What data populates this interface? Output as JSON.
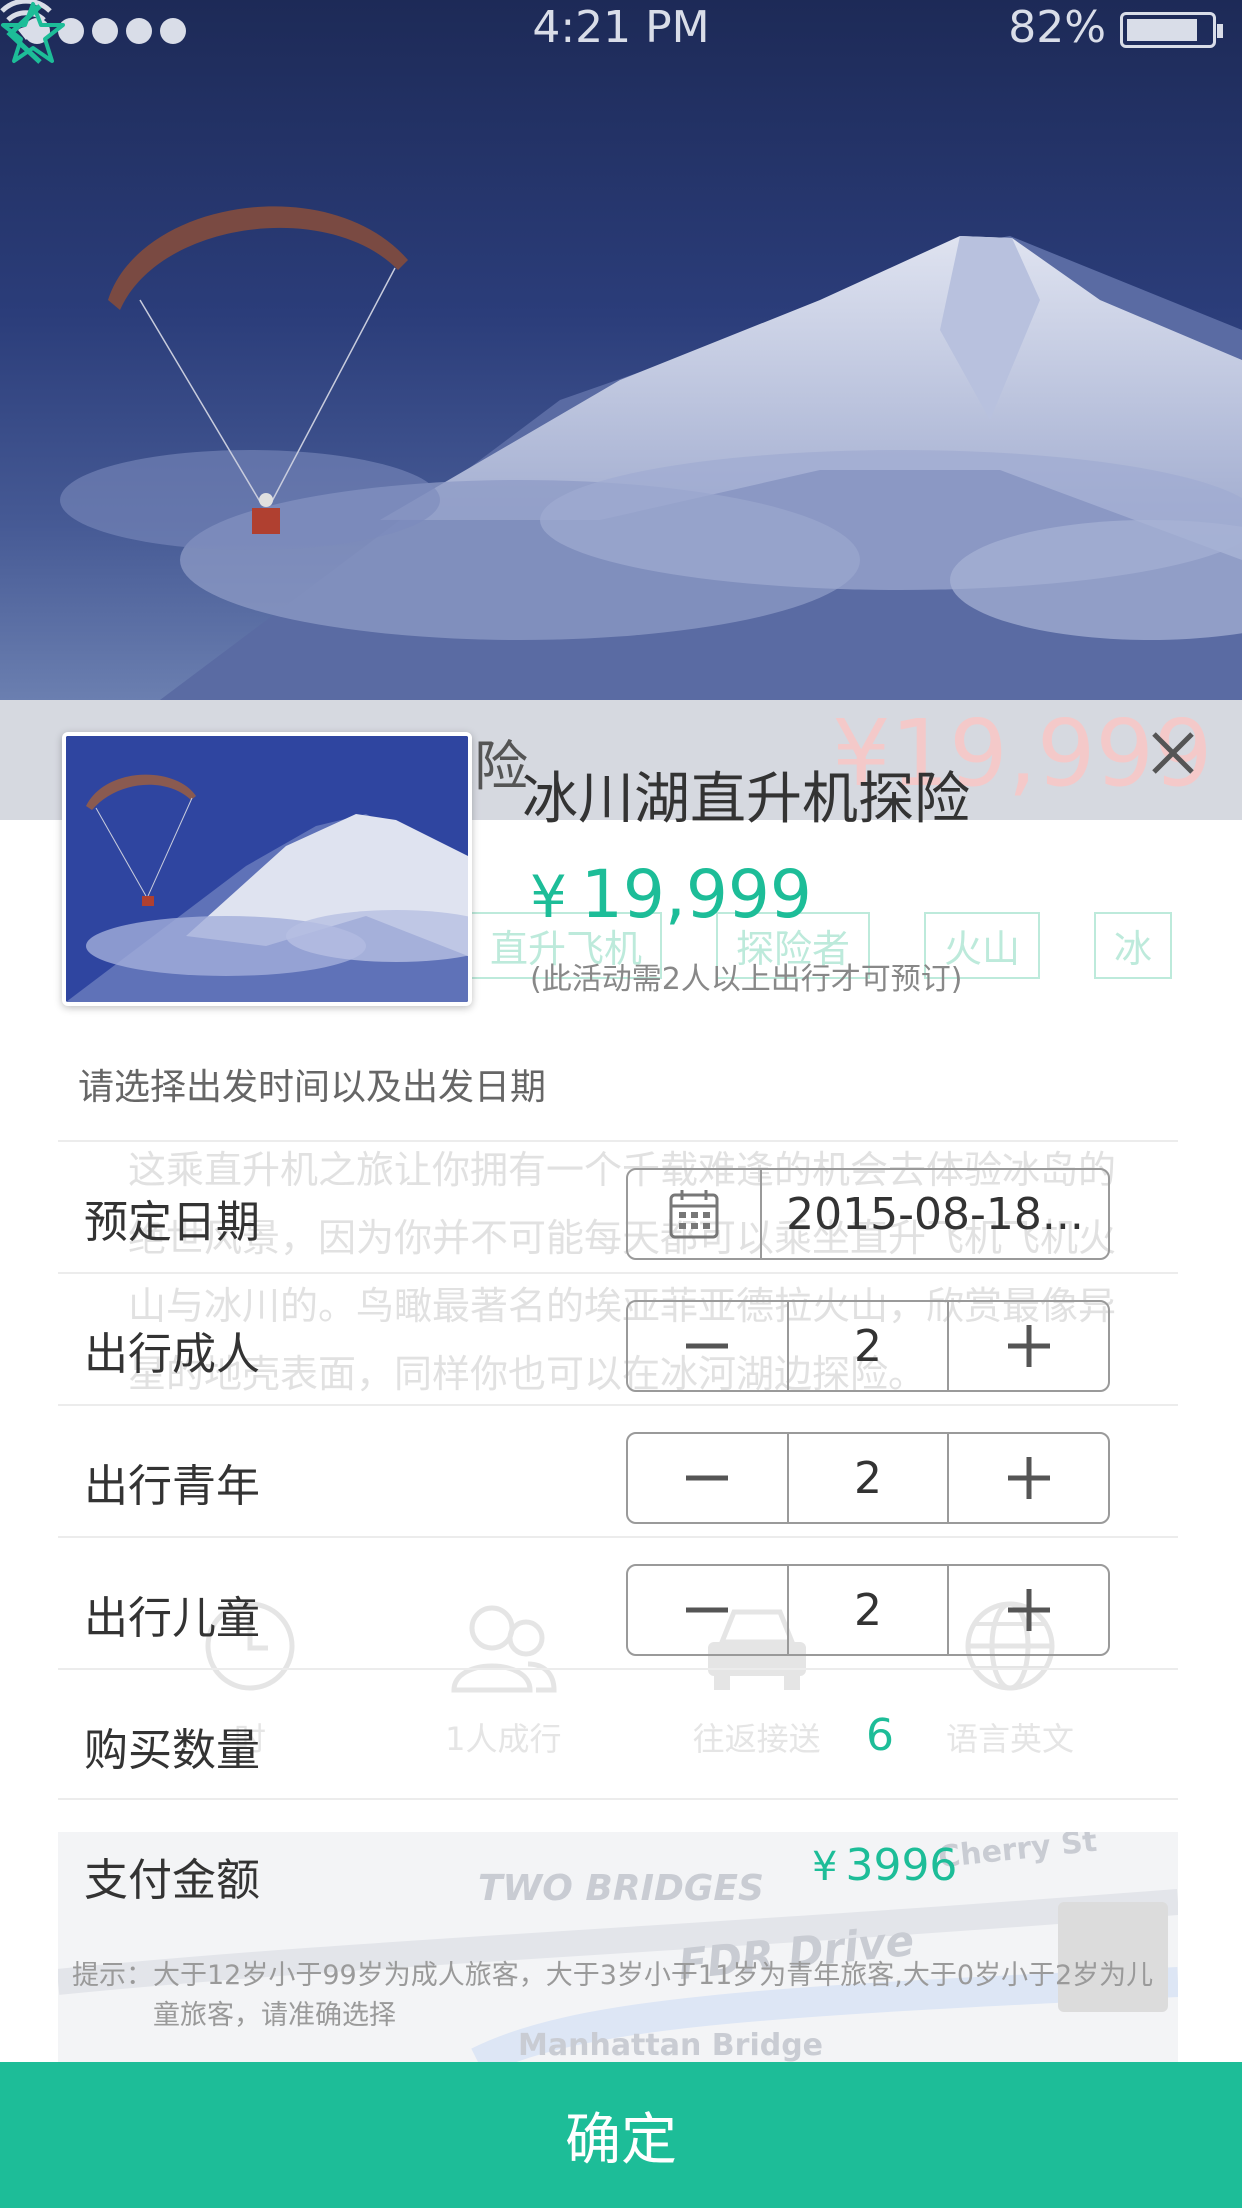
{
  "status_bar": {
    "time": "4:21 PM",
    "battery": "82%"
  },
  "background_page": {
    "title_fragment": "探险",
    "price": "¥19,999",
    "tags": [
      "直升飞机",
      "探险者",
      "火山",
      "冰"
    ],
    "description": "这乘直升机之旅让你拥有一个千载难逢的机会去体验冰岛的绝世风景，因为你并不可能每天都可以乘坐直升飞机飞机火山与冰川的。鸟瞰最著名的埃亚菲亚德拉火山，欣赏最像异星的地壳表面，同样你也可以在冰河湖边探险。",
    "features": [
      {
        "icon": "clock-icon",
        "label": "时"
      },
      {
        "icon": "people-icon",
        "label": "1人成行"
      },
      {
        "icon": "car-icon",
        "label": "往返接送"
      },
      {
        "icon": "globe-icon",
        "label": "语言英文"
      }
    ],
    "map_labels": [
      "TWO BRIDGES",
      "FDR Drive",
      "Cherry St",
      "Manhattan Bridge"
    ]
  },
  "sheet": {
    "title": "冰川湖直升机探险",
    "price_symbol": "¥",
    "price": "19,999",
    "note": "(此活动需2人以上出行才可预订)",
    "prompt": "请选择出发时间以及出发日期",
    "date_label": "预定日期",
    "date_value": "2015-08-18...",
    "adults_label": "出行成人",
    "adults_value": "2",
    "youth_label": "出行青年",
    "youth_value": "2",
    "children_label": "出行儿童",
    "children_value": "2",
    "quantity_label": "购买数量",
    "quantity_value": "6",
    "payment_label": "支付金额",
    "payment_symbol": "¥",
    "payment_value": "3996",
    "hint_prefix": "提示：",
    "hint_text": "大于12岁小于99岁为成人旅客，大于3岁小于11岁为青年旅客,大于0岁小于2岁为儿童旅客，请准确选择",
    "confirm_label": "确定"
  },
  "colors": {
    "accent": "#1dbd98",
    "hero_dark": "#1d2a57",
    "border": "#9a9a9a"
  }
}
